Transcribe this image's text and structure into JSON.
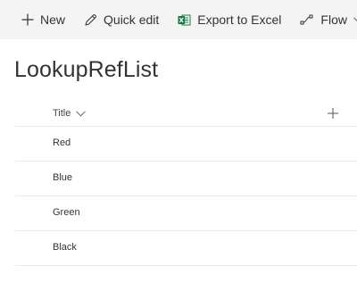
{
  "command_bar": {
    "new_label": "New",
    "quick_edit_label": "Quick edit",
    "export_label": "Export to Excel",
    "flow_label": "Flow",
    "icons": {
      "new": "plus-icon",
      "quick_edit": "pencil-icon",
      "export": "excel-icon",
      "flow": "flow-icon",
      "flow_menu": "chevron-down-icon"
    },
    "colors": {
      "excel_green": "#217346"
    }
  },
  "page": {
    "title": "LookupRefList"
  },
  "list": {
    "columns": [
      {
        "label": "Title"
      }
    ],
    "rows": [
      {
        "title": "Red"
      },
      {
        "title": "Blue"
      },
      {
        "title": "Green"
      },
      {
        "title": "Black"
      }
    ]
  }
}
